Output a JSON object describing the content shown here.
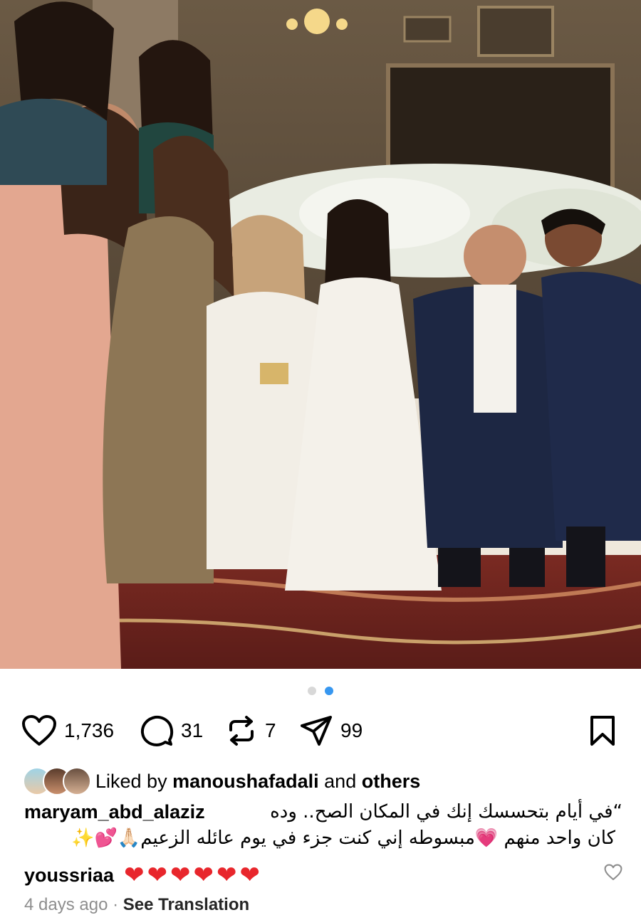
{
  "post": {
    "photo_description_icon": "family-photo",
    "carousel": {
      "count": 2,
      "active": 2,
      "active_color": "#3797f0",
      "inactive_color": "#d8d8d8"
    },
    "actions": {
      "likes": "1,736",
      "comments": "31",
      "reposts": "7",
      "shares": "99"
    },
    "liked_by": {
      "prefix": "Liked by",
      "user": "manoushafadali",
      "middle": "and",
      "suffix": "others"
    },
    "caption": {
      "user": "maryam_abd_alaziz",
      "line1": "“في أيام بتحسسك إنك في المكان الصح.. وده",
      "line2": "كان واحد منهم 💗مبسوطه إني كنت جزء في يوم عائله الزعيم🙏🏻💕✨"
    },
    "comment": {
      "user": "youssriaa",
      "text": "❤❤❤❤❤❤"
    },
    "meta": {
      "time": "4 days ago",
      "separator": "·",
      "translate": "See Translation"
    }
  }
}
